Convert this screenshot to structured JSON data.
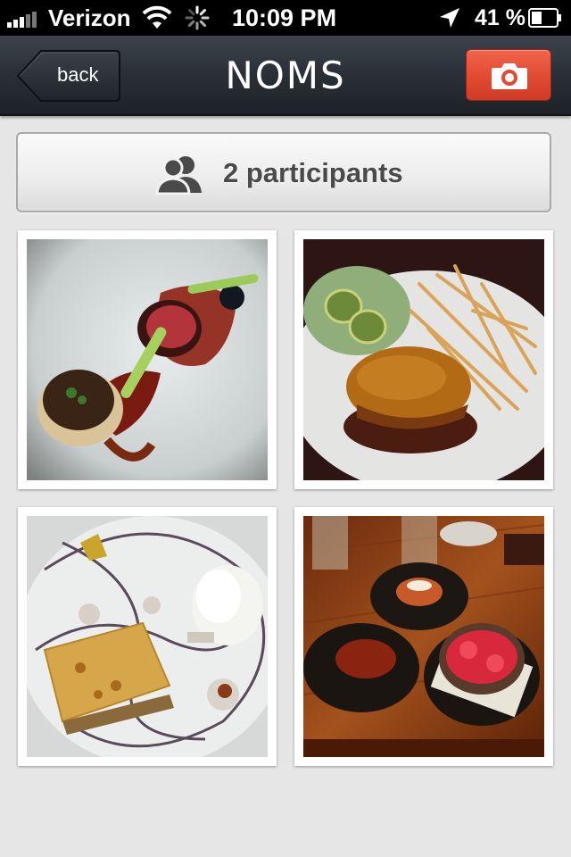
{
  "status_bar": {
    "carrier": "Verizon",
    "time": "10:09 PM",
    "battery_percent": "41 %",
    "battery_level": 0.41
  },
  "nav": {
    "back_label": "back",
    "title": "NOMS",
    "camera_icon": "camera-icon"
  },
  "participants": {
    "label": "2 participants",
    "icon": "people-icon"
  },
  "photos": [
    {
      "name": "photo-steak-plate",
      "colors": {
        "plate": "#d9dcdc",
        "accent": "#7a1a10"
      }
    },
    {
      "name": "photo-burger-fries",
      "colors": {
        "plate": "#e4e4e2",
        "accent": "#b36a14"
      }
    },
    {
      "name": "photo-dessert-plate",
      "colors": {
        "plate": "#e9ebeb",
        "accent": "#d6a64a"
      }
    },
    {
      "name": "photo-desserts-table",
      "colors": {
        "table": "#8a3a12",
        "accent": "#d8283c"
      }
    }
  ],
  "colors": {
    "camera_button": "#e24a32",
    "nav_bar": "#2b3138",
    "background": "#e6e6e6"
  }
}
